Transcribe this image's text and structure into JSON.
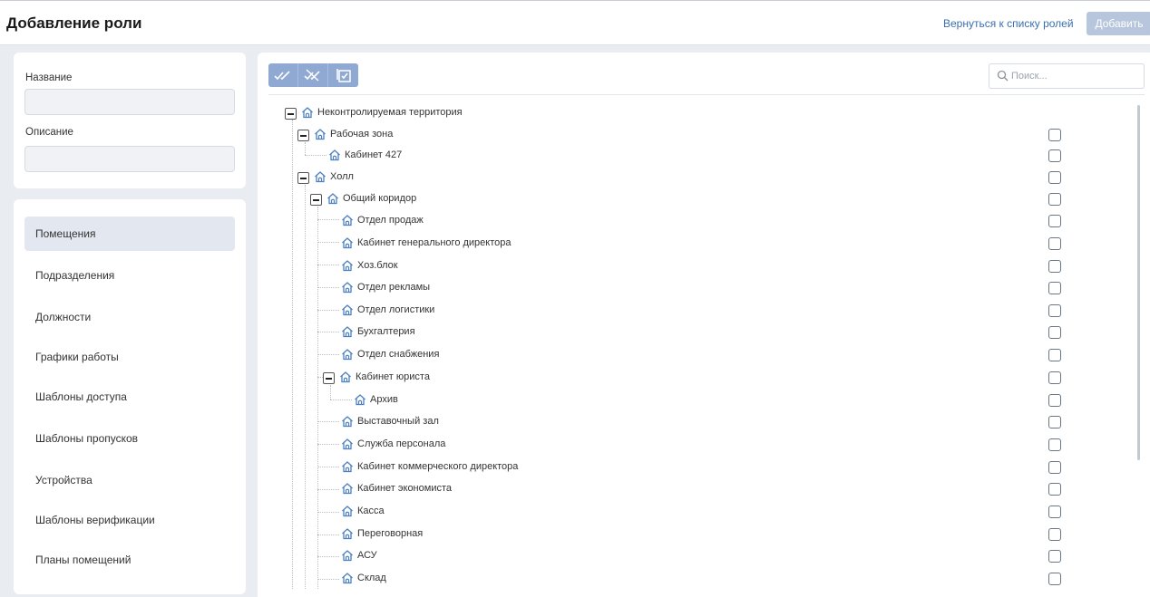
{
  "header": {
    "title": "Добавление роли",
    "back_link": "Вернуться к списку ролей",
    "add_button": "Добавить"
  },
  "form": {
    "name_label": "Название",
    "name_value": "",
    "description_label": "Описание",
    "description_value": ""
  },
  "nav": {
    "items": [
      {
        "label": "Помещения",
        "active": true
      },
      {
        "label": "Подразделения"
      },
      {
        "label": "Должности"
      },
      {
        "label": "Графики работы"
      },
      {
        "label": "Шаблоны доступа"
      },
      {
        "label": "Шаблоны пропусков"
      },
      {
        "label": "Устройства"
      },
      {
        "label": "Шаблоны верификации"
      },
      {
        "label": "Планы помещений"
      }
    ]
  },
  "toolbar": {
    "buttons": [
      {
        "icon": "check-all-icon"
      },
      {
        "icon": "uncheck-all-icon"
      },
      {
        "icon": "select-checkbox-icon"
      }
    ]
  },
  "search": {
    "placeholder": "Поиск..."
  },
  "tree": [
    {
      "label": "Неконтролируемая территория",
      "level": 0,
      "expanded": true,
      "checkbox": false
    },
    {
      "label": "Рабочая зона",
      "level": 1,
      "expanded": true,
      "checkbox": true
    },
    {
      "label": "Кабинет 427",
      "level": 2,
      "checkbox": true
    },
    {
      "label": "Холл",
      "level": 1,
      "expanded": true,
      "checkbox": true
    },
    {
      "label": "Общий коридор",
      "level": 2,
      "expanded": true,
      "checkbox": true
    },
    {
      "label": "Отдел продаж",
      "level": 3,
      "checkbox": true
    },
    {
      "label": "Кабинет генерального директора",
      "level": 3,
      "checkbox": true
    },
    {
      "label": "Хоз.блок",
      "level": 3,
      "checkbox": true
    },
    {
      "label": "Отдел рекламы",
      "level": 3,
      "checkbox": true
    },
    {
      "label": "Отдел логистики",
      "level": 3,
      "checkbox": true
    },
    {
      "label": "Бухгалтерия",
      "level": 3,
      "checkbox": true
    },
    {
      "label": "Отдел снабжения",
      "level": 3,
      "checkbox": true
    },
    {
      "label": "Кабинет юриста",
      "level": 3,
      "expanded": true,
      "checkbox": true
    },
    {
      "label": "Архив",
      "level": 4,
      "checkbox": true
    },
    {
      "label": "Выставочный зал",
      "level": 3,
      "checkbox": true
    },
    {
      "label": "Служба персонала",
      "level": 3,
      "checkbox": true
    },
    {
      "label": "Кабинет коммерческого директора",
      "level": 3,
      "checkbox": true
    },
    {
      "label": "Кабинет экономиста",
      "level": 3,
      "checkbox": true
    },
    {
      "label": "Касса",
      "level": 3,
      "checkbox": true
    },
    {
      "label": "Переговорная",
      "level": 3,
      "checkbox": true
    },
    {
      "label": "АСУ",
      "level": 3,
      "checkbox": true
    },
    {
      "label": "Склад",
      "level": 3,
      "checkbox": true
    }
  ],
  "colors": {
    "accent": "#8fa9d3",
    "link": "#3a6fb0",
    "node_icon": "#4a7fc1",
    "background": "#e9ecf1"
  }
}
